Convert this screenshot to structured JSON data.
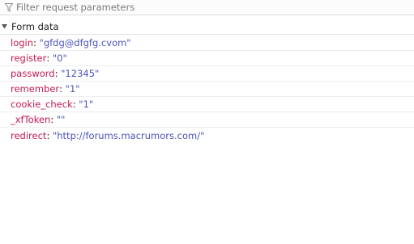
{
  "filter": {
    "placeholder": "Filter request parameters",
    "icon": "filter-icon"
  },
  "section": {
    "title": "Form data",
    "expanded": true
  },
  "colors": {
    "key": "#c41a4e",
    "value": "#4a55b8"
  },
  "params": [
    {
      "key": "login",
      "value": "\"gfdg@dfgfg.cvom\""
    },
    {
      "key": "register",
      "value": "\"0\""
    },
    {
      "key": "password",
      "value": "\"12345\""
    },
    {
      "key": "remember",
      "value": "\"1\""
    },
    {
      "key": "cookie_check",
      "value": "\"1\""
    },
    {
      "key": "_xfToken",
      "value": "\"\""
    },
    {
      "key": "redirect",
      "value": "\"http://forums.macrumors.com/\""
    }
  ]
}
